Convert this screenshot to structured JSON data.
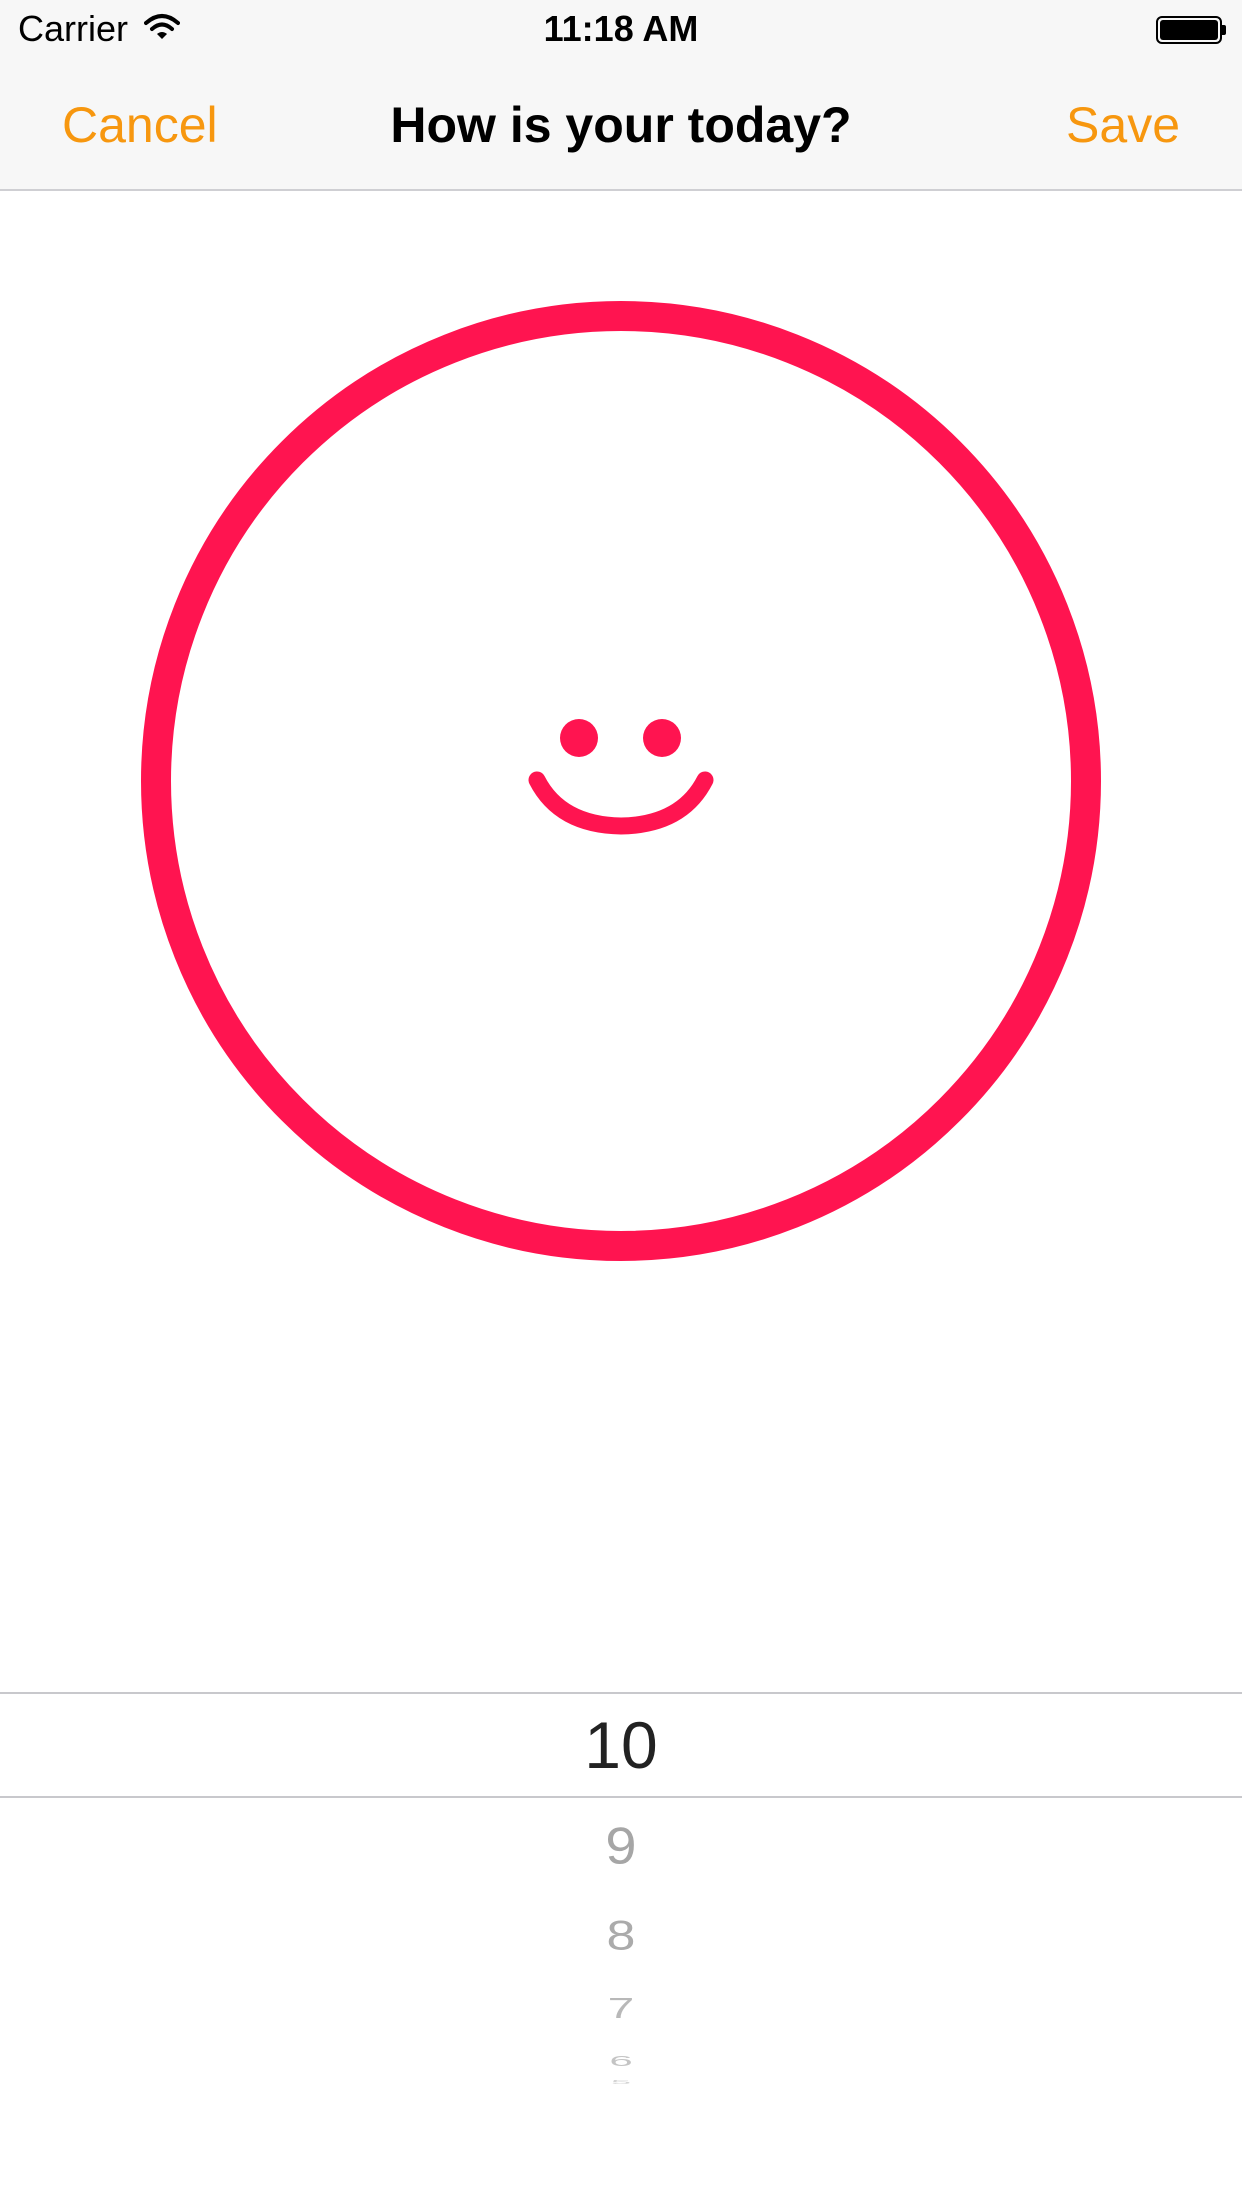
{
  "status_bar": {
    "carrier": "Carrier",
    "time": "11:18 AM",
    "wifi_icon": "wifi-icon",
    "battery_icon": "battery-icon"
  },
  "nav": {
    "cancel_label": "Cancel",
    "title": "How is your today?",
    "save_label": "Save"
  },
  "face": {
    "icon": "smiley-face-icon",
    "color": "#ff1450"
  },
  "picker": {
    "selected": "10",
    "items": [
      "9",
      "8",
      "7",
      "6",
      "5"
    ]
  },
  "colors": {
    "accent": "#f7970f",
    "face": "#ff1450"
  }
}
